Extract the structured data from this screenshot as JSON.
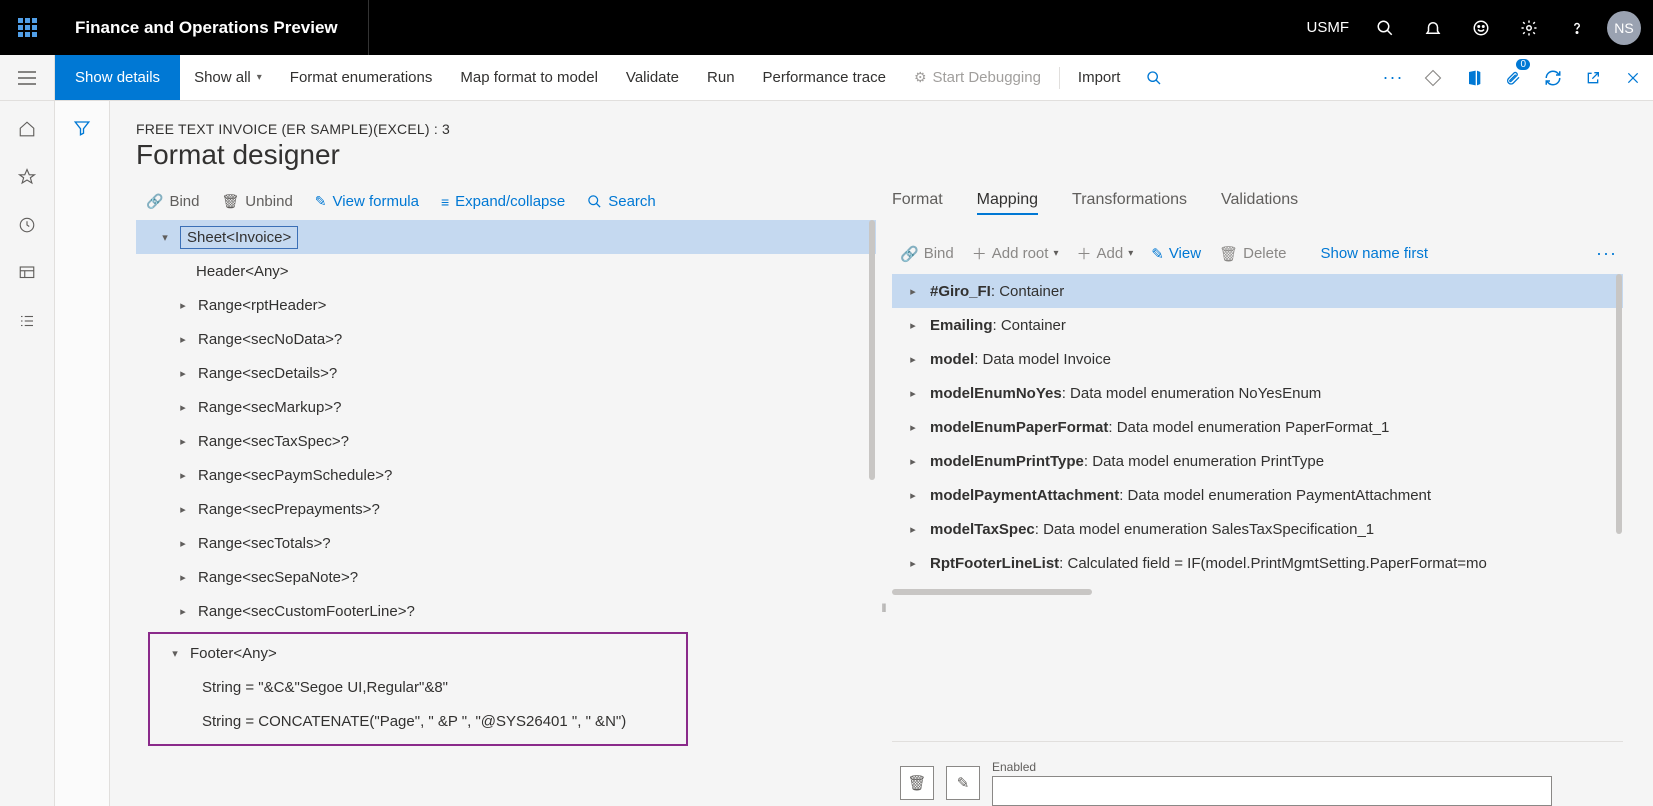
{
  "topbar": {
    "app_title": "Finance and Operations Preview",
    "legal_entity": "USMF",
    "avatar_initials": "NS"
  },
  "commandbar": {
    "show_details": "Show details",
    "show_all": "Show all",
    "format_enumerations": "Format enumerations",
    "map_format": "Map format to model",
    "validate": "Validate",
    "run": "Run",
    "perf_trace": "Performance trace",
    "start_debug": "Start Debugging",
    "import": "Import"
  },
  "page": {
    "breadcrumb": "FREE TEXT INVOICE (ER SAMPLE)(EXCEL) : 3",
    "title": "Format designer"
  },
  "left_toolbar": {
    "bind": "Bind",
    "unbind": "Unbind",
    "view_formula": "View formula",
    "expand_collapse": "Expand/collapse",
    "search": "Search"
  },
  "tree": {
    "root": "Sheet<Invoice>",
    "nodes": [
      "Header<Any>",
      "Range<rptHeader>",
      "Range<secNoData>?",
      "Range<secDetails>?",
      "Range<secMarkup>?",
      "Range<secTaxSpec>?",
      "Range<secPaymSchedule>?",
      "Range<secPrepayments>?",
      "Range<secTotals>?",
      "Range<secSepaNote>?",
      "Range<secCustomFooterLine>?"
    ],
    "footer": {
      "label": "Footer<Any>",
      "c1": "String = \"&C&\"Segoe UI,Regular\"&8\"",
      "c2": "String = CONCATENATE(\"Page\", \" &P \", \"@SYS26401 \", \" &N\")"
    }
  },
  "tabs": {
    "format": "Format",
    "mapping": "Mapping",
    "transformations": "Transformations",
    "validations": "Validations"
  },
  "right_toolbar": {
    "bind": "Bind",
    "add_root": "Add root",
    "add": "Add",
    "view": "View",
    "delete": "Delete",
    "show_name_first": "Show name first"
  },
  "mapping_tree": [
    {
      "bold": "#Giro_FI",
      "rest": ": Container",
      "selected": true
    },
    {
      "bold": "Emailing",
      "rest": ": Container"
    },
    {
      "bold": "model",
      "rest": ": Data model Invoice"
    },
    {
      "bold": "modelEnumNoYes",
      "rest": ": Data model enumeration NoYesEnum"
    },
    {
      "bold": "modelEnumPaperFormat",
      "rest": ": Data model enumeration PaperFormat_1"
    },
    {
      "bold": "modelEnumPrintType",
      "rest": ": Data model enumeration PrintType"
    },
    {
      "bold": "modelPaymentAttachment",
      "rest": ": Data model enumeration PaymentAttachment"
    },
    {
      "bold": "modelTaxSpec",
      "rest": ": Data model enumeration SalesTaxSpecification_1"
    },
    {
      "bold": "RptFooterLineList",
      "rest": ": Calculated field = IF(model.PrintMgmtSetting.PaperFormat=mo"
    }
  ],
  "bottom": {
    "enabled_label": "Enabled"
  },
  "attach_badge": "0"
}
